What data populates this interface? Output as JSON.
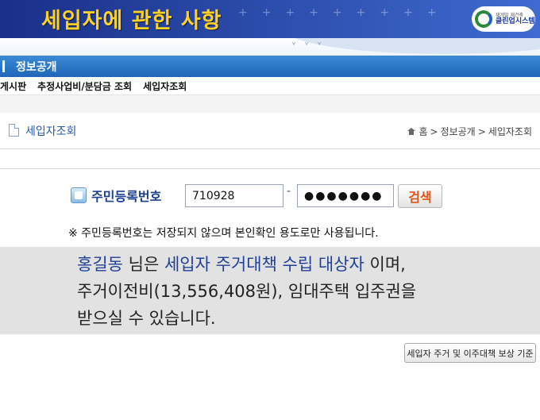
{
  "header": {
    "title": "세입자에 관한 사항",
    "logo": {
      "small_text": "재개발 재건축",
      "name": "클린업시스템"
    }
  },
  "section": {
    "title": "정보공개"
  },
  "subnav": {
    "items": [
      "게시판",
      "추정사업비/분담금 조회",
      "세입자조회"
    ]
  },
  "page": {
    "title": "세입자조회",
    "breadcrumb": {
      "home": "홈",
      "sep": ">",
      "items": [
        "정보공개",
        "세입자조회"
      ]
    }
  },
  "form": {
    "label": "주민등록번호",
    "first_value": "710928",
    "dash": "-",
    "second_value": "●●●●●●●",
    "search_label": "검색",
    "notice": "※ 주민등록번호는 저장되지 않으며 본인확인 용도로만 사용됩니다."
  },
  "result": {
    "name": "홍길동",
    "suffix1": " 님은 ",
    "status": "세입자 주거대책 수립 대상자",
    "suffix2": " 이며,",
    "line2": "주거이전비(13,556,408원), 임대주택 입주권을",
    "line3": "받으실 수 있습니다."
  },
  "criteria_button": {
    "label": "세입자 주거 및 이주대책 보상 기준"
  },
  "colors": {
    "banner": "#2a4aa8",
    "banner_title": "#ffd21f",
    "section_bar": "#1f66b8",
    "highlight_text": "#1f3f98",
    "search_button_text": "#e0561a"
  }
}
